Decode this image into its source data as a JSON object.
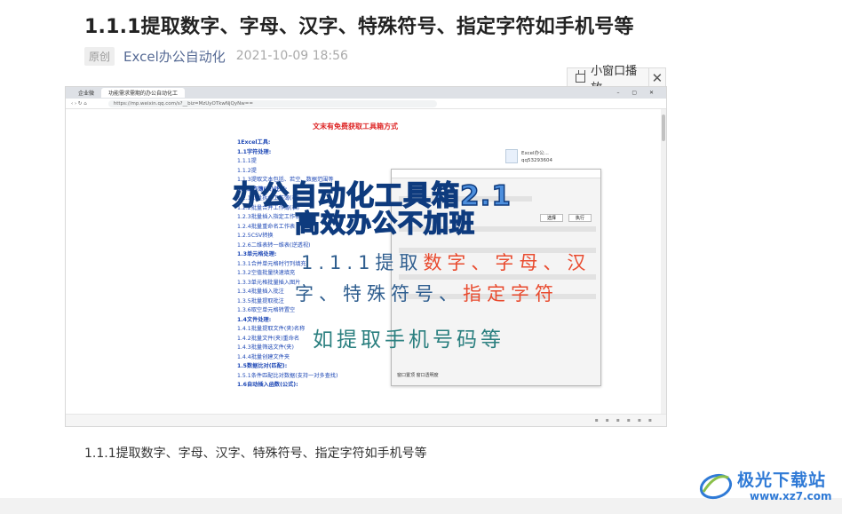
{
  "article": {
    "title": "1.1.1提取数字、字母、汉字、特殊符号、指定字符如手机号等",
    "badge": "原创",
    "author": "Excel办公自动化",
    "date": "2021-10-09 18:56",
    "caption": "1.1.1提取数字、字母、汉字、特殊符号、指定字符如手机号等"
  },
  "mini_player": {
    "label": "小窗口播放",
    "close": "✕"
  },
  "video": {
    "browser_tab_1": "企业微",
    "browser_tab_2": "功能需求需期的办公自动化工",
    "address": "https://mp.weixin.qq.com/s?__biz=MzUyOTkwNjQyNw==",
    "doc_header": "文末有免费获取工具箱方式",
    "contact_name": "Excel办公...",
    "contact_id": "qq53293604",
    "doc_items": [
      "1Excel工具:",
      "1.1字符处理:",
      "1.1.1提",
      "1.1.2提",
      "1.1.3提取文本包括、若空、数据范围等",
      "1.2工作簿(表)处理:",
      "1.2.1批量拆分工作簿(表)",
      "1.2.2批量合并工作簿(表)",
      "1.2.3批量插入指定工作表",
      "1.2.4批量重命名工作表",
      "1.2.5CSV转换",
      "1.2.6二维表转一维表(逆透视)",
      "1.3单元格处理:",
      "1.3.1合并单元格时行列填充",
      "1.3.2空值批量快速填充",
      "1.3.3单元格批量插入图片",
      "1.3.4批量插入批注",
      "1.3.5批量提取批注",
      "1.3.6取空单元格转置空",
      "1.4文件处理:",
      "1.4.1批量提取文件(夹)名称",
      "1.4.2批量文件(夹)重命名",
      "1.4.3批量筛选文件(夹)",
      "1.4.4批量创建文件夹",
      "1.5数据比对(匹配):",
      "1.5.1条件匹配比对数据(支持一对多查找)",
      "1.6自动插入函数(公式):"
    ],
    "dialog_btn_1": "选择",
    "dialog_btn_2": "执行",
    "dialog_footer": "窗口置顶   窗口透明度",
    "overlay_line1": "办公自动化工具箱2.1",
    "overlay_line2": "高效办公不加班",
    "overlay_line3_a": "1.1.1提取",
    "overlay_line3_b": "数字、字母、汉",
    "overlay_line4_a": "字、",
    "overlay_line4_b": "特殊符号、",
    "overlay_line4_c": "指定字符",
    "overlay_line5": "如提取手机号码等"
  },
  "watermark": {
    "name": "极光下载站",
    "url": "www.xz7.com"
  },
  "colors": {
    "author_link": "#576b95",
    "overlay_blue": "#4d8fdd",
    "overlay_red": "#e94b2f",
    "watermark_blue": "#2f7ad6"
  }
}
